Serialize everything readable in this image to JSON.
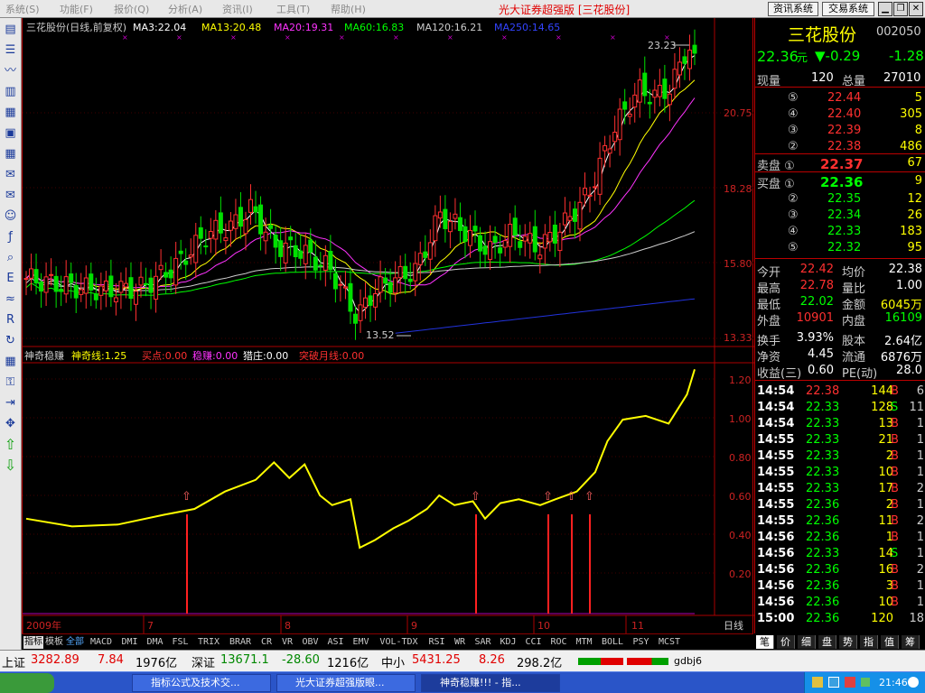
{
  "menu": {
    "items": [
      "系统(S)",
      "功能(F)",
      "报价(Q)",
      "分析(A)",
      "资讯(I)",
      "工具(T)",
      "帮助(H)"
    ],
    "title": "光大证券超强版 [三花股份]",
    "info_btn": "资讯系统",
    "trade_btn": "交易系统"
  },
  "toolbar": {
    "icons": [
      "quote-icon",
      "list-icon",
      "chart-icon",
      "kline-icon",
      "panel-icon",
      "table-icon",
      "grid-icon",
      "news-icon",
      "mail-icon",
      "users-icon",
      "f10-icon",
      "search-icon",
      "eif-icon",
      "wave-icon",
      "rsi-icon",
      "refresh-icon",
      "multi-icon",
      "lock-icon",
      "exit-icon",
      "move-icon",
      "up-arrow-icon",
      "down-arrow-icon"
    ]
  },
  "chart": {
    "header": {
      "name": "三花股份(日线,前复权)",
      "ma3": "MA3:22.04",
      "ma13": "MA13:20.48",
      "ma20": "MA20:19.31",
      "ma60": "MA60:16.83",
      "ma120": "MA120:16.21",
      "ma250": "MA250:14.65"
    },
    "y_ticks": [
      "20.75",
      "18.28",
      "15.80",
      "13.33"
    ],
    "high_label": "23.23",
    "low_label": "13.52",
    "indicator": {
      "title": "神奇稳赚",
      "line": "神奇线:1.25",
      "buy": "买点:0.00",
      "earn": "稳赚:0.00",
      "zhuang": "猎庄:0.00",
      "breakout": "突破月线:0.00",
      "y_ticks": [
        "1.20",
        "1.00",
        "0.80",
        "0.60",
        "0.40",
        "0.20"
      ]
    },
    "x_labels": {
      "year": "2009年",
      "months": [
        "7",
        "8",
        "9",
        "10",
        "11"
      ],
      "period": "日线"
    }
  },
  "tabs": [
    "指标",
    "模板",
    "全部",
    "MACD",
    "DMI",
    "DMA",
    "FSL",
    "TRIX",
    "BRAR",
    "CR",
    "VR",
    "OBV",
    "ASI",
    "EMV",
    "VOL-TDX",
    "RSI",
    "WR",
    "SAR",
    "KDJ",
    "CCI",
    "ROC",
    "MTM",
    "BOLL",
    "PSY",
    "MCST"
  ],
  "quote": {
    "name": "三花股份",
    "code": "002050",
    "price": "22.36",
    "unit": "元",
    "change": "▼-0.29",
    "pct": "-1.28",
    "vol_now_label": "现量",
    "vol_now": "120",
    "vol_total_label": "总量",
    "vol_total": "27010",
    "sell": [
      {
        "idx": "⑤",
        "p": "22.44",
        "v": "5"
      },
      {
        "idx": "④",
        "p": "22.40",
        "v": "305"
      },
      {
        "idx": "③",
        "p": "22.39",
        "v": "8"
      },
      {
        "idx": "②",
        "p": "22.38",
        "v": "486"
      },
      {
        "idx": "卖盘 ①",
        "p": "22.37",
        "v": "67"
      }
    ],
    "buy": [
      {
        "idx": "买盘 ①",
        "p": "22.36",
        "v": "9"
      },
      {
        "idx": "②",
        "p": "22.35",
        "v": "12"
      },
      {
        "idx": "③",
        "p": "22.34",
        "v": "26"
      },
      {
        "idx": "④",
        "p": "22.33",
        "v": "183"
      },
      {
        "idx": "⑤",
        "p": "22.32",
        "v": "95"
      }
    ],
    "stats": [
      {
        "l1": "今开",
        "v1": "22.42",
        "c1": "#ff3030",
        "l2": "均价",
        "v2": "22.38",
        "c2": "#ffffff"
      },
      {
        "l1": "最高",
        "v1": "22.78",
        "c1": "#ff3030",
        "l2": "量比",
        "v2": "1.00",
        "c2": "#ffffff"
      },
      {
        "l1": "最低",
        "v1": "22.02",
        "c1": "#00ff00",
        "l2": "金额",
        "v2": "6045万",
        "c2": "#ffff00"
      },
      {
        "l1": "外盘",
        "v1": "10901",
        "c1": "#ff3030",
        "l2": "内盘",
        "v2": "16109",
        "c2": "#00ff00"
      },
      {
        "l1": "换手",
        "v1": "3.93%",
        "c1": "#ffffff",
        "l2": "股本",
        "v2": "2.64亿",
        "c2": "#ffffff"
      },
      {
        "l1": "净资",
        "v1": "4.45",
        "c1": "#ffffff",
        "l2": "流通",
        "v2": "6876万",
        "c2": "#ffffff"
      },
      {
        "l1": "收益(三)",
        "v1": "0.60",
        "c1": "#ffffff",
        "l2": "PE(动)",
        "v2": "28.0",
        "c2": "#ffffff"
      }
    ],
    "ticks": [
      {
        "t": "14:54",
        "p": "22.38",
        "v": "144",
        "s": "B",
        "n": "6"
      },
      {
        "t": "14:54",
        "p": "22.33",
        "v": "128",
        "s": "S",
        "n": "11"
      },
      {
        "t": "14:54",
        "p": "22.33",
        "v": "13",
        "s": "B",
        "n": "1"
      },
      {
        "t": "14:55",
        "p": "22.33",
        "v": "21",
        "s": "B",
        "n": "1"
      },
      {
        "t": "14:55",
        "p": "22.33",
        "v": "2",
        "s": "B",
        "n": "1"
      },
      {
        "t": "14:55",
        "p": "22.33",
        "v": "10",
        "s": "B",
        "n": "1"
      },
      {
        "t": "14:55",
        "p": "22.33",
        "v": "17",
        "s": "B",
        "n": "2"
      },
      {
        "t": "14:55",
        "p": "22.36",
        "v": "2",
        "s": "B",
        "n": "1"
      },
      {
        "t": "14:55",
        "p": "22.36",
        "v": "11",
        "s": "B",
        "n": "2"
      },
      {
        "t": "14:56",
        "p": "22.36",
        "v": "1",
        "s": "B",
        "n": "1"
      },
      {
        "t": "14:56",
        "p": "22.33",
        "v": "14",
        "s": "S",
        "n": "1"
      },
      {
        "t": "14:56",
        "p": "22.36",
        "v": "16",
        "s": "B",
        "n": "2"
      },
      {
        "t": "14:56",
        "p": "22.36",
        "v": "3",
        "s": "B",
        "n": "1"
      },
      {
        "t": "14:56",
        "p": "22.36",
        "v": "10",
        "s": "B",
        "n": "1"
      },
      {
        "t": "15:00",
        "p": "22.36",
        "v": "120",
        "s": "",
        "n": "18"
      }
    ],
    "side_tabs": [
      "笔",
      "价",
      "细",
      "盘",
      "势",
      "指",
      "值",
      "筹"
    ]
  },
  "status": {
    "sh_label": "上证",
    "sh": "3282.89",
    "sh_chg": "7.84",
    "sh_amt": "1976亿",
    "sz_label": "深证",
    "sz": "13671.1",
    "sz_chg": "-28.60",
    "sz_amt": "1216亿",
    "zx_label": "中小",
    "zx": "5431.25",
    "zx_chg": "8.26",
    "zx_amt": "298.2亿",
    "user": "gdbj6"
  },
  "taskbar": {
    "tasks": [
      "指标公式及技术交...",
      "光大证券超强版眼...",
      "神奇稳赚!!! - 指..."
    ],
    "time": "21:46"
  }
}
